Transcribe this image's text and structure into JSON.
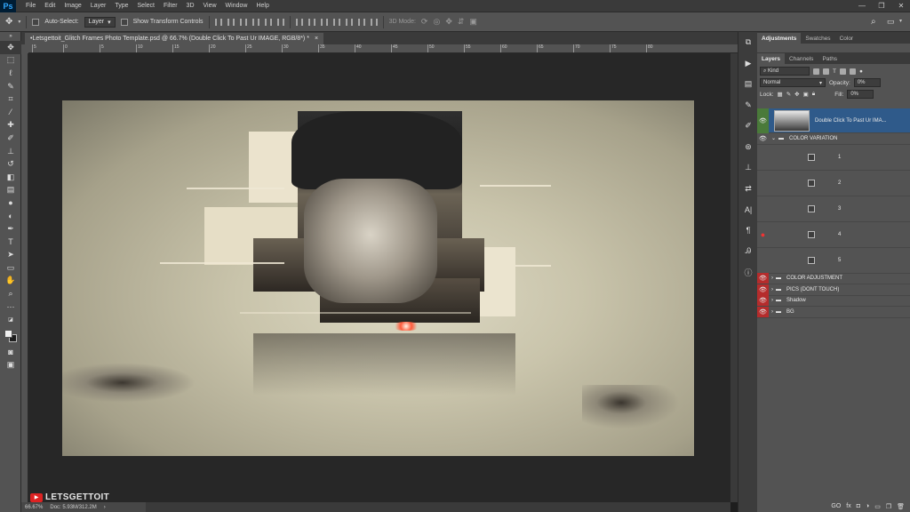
{
  "menubar": {
    "logo": "Ps",
    "items": [
      "File",
      "Edit",
      "Image",
      "Layer",
      "Type",
      "Select",
      "Filter",
      "3D",
      "View",
      "Window",
      "Help"
    ],
    "window_controls": [
      "—",
      "❐",
      "✕"
    ]
  },
  "options": {
    "auto_select_label": "Auto-Select:",
    "auto_select_value": "Layer",
    "transform_label": "Show Transform Controls",
    "mode3d_label": "3D Mode:"
  },
  "document": {
    "tab_title": "•Letsgettoit_Glitch Frames Photo Template.psd @ 66.7% (Double Click To Past Ur IMAGE, RGB/8*) *",
    "close": "×"
  },
  "ruler": {
    "ticks": [
      "5",
      "0",
      "5",
      "10",
      "15",
      "20",
      "25",
      "30",
      "35",
      "40",
      "45",
      "50",
      "55",
      "60",
      "65",
      "70",
      "75",
      "80"
    ]
  },
  "status": {
    "zoom": "66.67%",
    "doc": "Doc: 5.93M/312.2M"
  },
  "watermark": {
    "icon": "▶",
    "text": "LETSGETTOIT"
  },
  "panels": {
    "top_tabs": [
      "Adjustments",
      "Swatches",
      "Color"
    ],
    "layer_tabs": [
      "Layers",
      "Channels",
      "Paths"
    ],
    "kind_label": "Kind",
    "blend_mode": "Normal",
    "opacity_label": "Opacity:",
    "opacity_value": "0%",
    "lock_label": "Lock:",
    "fill_label": "Fill:",
    "fill_value": "0%",
    "layers": [
      {
        "name": "Double Click To Past Ur IMA...",
        "type": "smart",
        "visible": true
      },
      {
        "name": "COLOR VARIATION",
        "type": "group",
        "visible": true
      },
      {
        "name": "1",
        "type": "adjustment",
        "visible": false
      },
      {
        "name": "2",
        "type": "adjustment",
        "visible": false
      },
      {
        "name": "3",
        "type": "adjustment",
        "visible": false
      },
      {
        "name": "4",
        "type": "adjustment",
        "visible": false
      },
      {
        "name": "5",
        "type": "adjustment",
        "visible": false
      },
      {
        "name": "COLOR ADJUSTMENT",
        "type": "group",
        "visible": true
      },
      {
        "name": "PICS (DONT TOUCH)",
        "type": "group",
        "visible": true
      },
      {
        "name": "Shadow",
        "type": "group",
        "visible": true
      },
      {
        "name": "BG",
        "type": "group",
        "visible": true
      }
    ],
    "bottom_icons": [
      "GO",
      "fx",
      "◘",
      "◑",
      "▭",
      "❐",
      "🗑"
    ]
  }
}
